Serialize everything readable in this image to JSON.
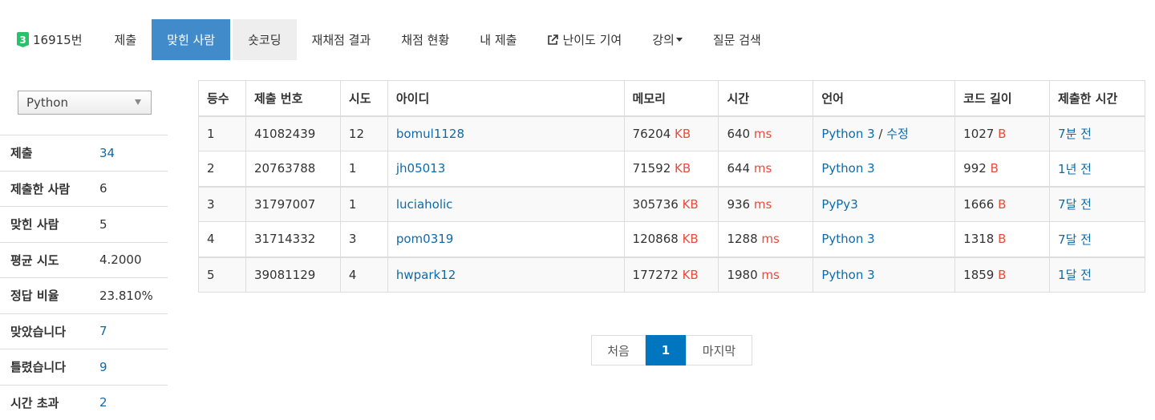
{
  "nav": {
    "problem_tier": "3",
    "problem_number": "16915번",
    "items": [
      "제출",
      "맞힌 사람",
      "숏코딩",
      "재채점 결과",
      "채점 현황",
      "내 제출",
      "난이도 기여",
      "강의",
      "질문 검색"
    ]
  },
  "sidebar": {
    "language_select": "Python",
    "stats": [
      {
        "label": "제출",
        "value": "34"
      },
      {
        "label": "제출한 사람",
        "value": "6"
      },
      {
        "label": "맞힌 사람",
        "value": "5"
      },
      {
        "label": "평균 시도",
        "value": "4.2000"
      },
      {
        "label": "정답 비율",
        "value": "23.810%"
      },
      {
        "label": "맞았습니다",
        "value": "7"
      },
      {
        "label": "틀렸습니다",
        "value": "9"
      },
      {
        "label": "시간 초과",
        "value": "2"
      }
    ]
  },
  "table": {
    "headers": [
      "등수",
      "제출 번호",
      "시도",
      "아이디",
      "메모리",
      "시간",
      "언어",
      "코드 길이",
      "제출한 시간"
    ],
    "rows": [
      {
        "rank": "1",
        "submission": "41082439",
        "tries": "12",
        "user": "bomul1128",
        "memory": "76204",
        "time": "640",
        "lang": "Python 3",
        "lang_extra": "수정",
        "code_len": "1027",
        "submitted": "7분 전"
      },
      {
        "rank": "2",
        "submission": "20763788",
        "tries": "1",
        "user": "jh05013",
        "memory": "71592",
        "time": "644",
        "lang": "Python 3",
        "lang_extra": "",
        "code_len": "992",
        "submitted": "1년 전"
      },
      {
        "rank": "3",
        "submission": "31797007",
        "tries": "1",
        "user": "luciaholic",
        "memory": "305736",
        "time": "936",
        "lang": "PyPy3",
        "lang_extra": "",
        "code_len": "1666",
        "submitted": "7달 전"
      },
      {
        "rank": "4",
        "submission": "31714332",
        "tries": "3",
        "user": "pom0319",
        "memory": "120868",
        "time": "1288",
        "lang": "Python 3",
        "lang_extra": "",
        "code_len": "1318",
        "submitted": "7달 전"
      },
      {
        "rank": "5",
        "submission": "39081129",
        "tries": "4",
        "user": "hwpark12",
        "memory": "177272",
        "time": "1980",
        "lang": "Python 3",
        "lang_extra": "",
        "code_len": "1859",
        "submitted": "1달 전"
      }
    ],
    "units": {
      "memory": "KB",
      "time": "ms",
      "code": "B"
    }
  },
  "pagination": {
    "first": "처음",
    "current": "1",
    "last": "마지막"
  },
  "colors": {
    "active_tab": "#428bca",
    "link": "#0f6aa8",
    "unit": "#e74c3c",
    "tier_badge": "#27c36a",
    "page_current": "#0076c0"
  }
}
